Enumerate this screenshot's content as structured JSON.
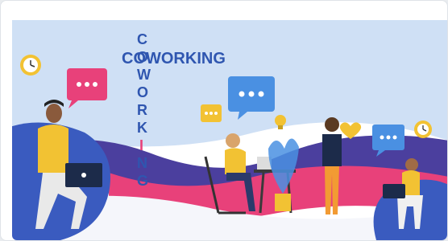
{
  "illustration": {
    "horizontal_word": "COWORKING",
    "vertical_letters": [
      "C",
      "O",
      "W",
      "O",
      "R",
      "K",
      "I",
      "N",
      "G"
    ],
    "icons": [
      "clock-icon",
      "chat-bubble-icon",
      "chat-bubble-icon",
      "chat-bubble-icon",
      "lightbulb-icon",
      "heart-icon",
      "clock-icon"
    ],
    "colors": {
      "sky": "#cfe0f5",
      "purple_wave": "#4b3f9e",
      "pink_wave": "#e8417a",
      "blue_blob": "#3a5bbf",
      "yellow": "#f2c233",
      "text_blue": "#2f56b0"
    }
  }
}
